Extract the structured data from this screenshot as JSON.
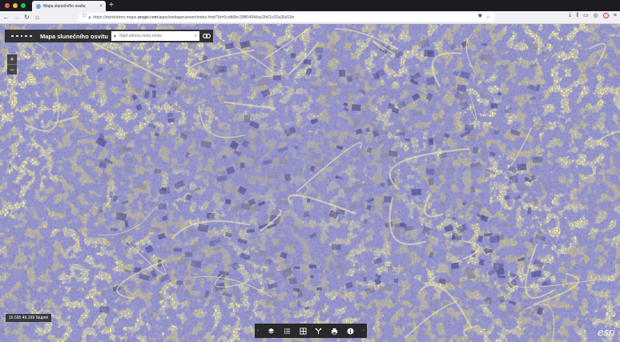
{
  "browser": {
    "tab_title": "Mapa slunečního osvitu",
    "tab_close": "×",
    "new_tab": "+",
    "url_prefix": "https://mestobrno.maps.",
    "url_domain": "arcgis.com",
    "url_rest": "/apps/webappviewer/index.html?id=5cdb6bc28ff04944ac2b61c02a36d19e",
    "icons": [
      "back-icon",
      "forward-icon",
      "reload-icon",
      "home-icon",
      "shield-icon",
      "lock-icon",
      "pocket-icon",
      "star-icon",
      "download-icon",
      "library-icon",
      "sidebar-icon",
      "extension-icon",
      "opera-icon",
      "menu-icon"
    ]
  },
  "app": {
    "title": "Mapa slunečního osvitu",
    "search_placeholder": "Najít adresu nebo místo",
    "coordinates": "16.595 49.199 Stupně",
    "attribution": "esri"
  },
  "zoom": {
    "in": "+",
    "out": "−"
  },
  "widgets": {
    "prev": "‹",
    "next": "›",
    "items": [
      "layers-icon",
      "legend-icon",
      "basemap-gallery-icon",
      "measure-icon",
      "print-icon",
      "info-icon"
    ]
  },
  "colors": {
    "sun_high": "#f2e04a",
    "sun_mid": "#b9b07a",
    "sun_low": "#5a5a9e",
    "accent_blue": "#3f3f8f",
    "panel": "#282828"
  }
}
